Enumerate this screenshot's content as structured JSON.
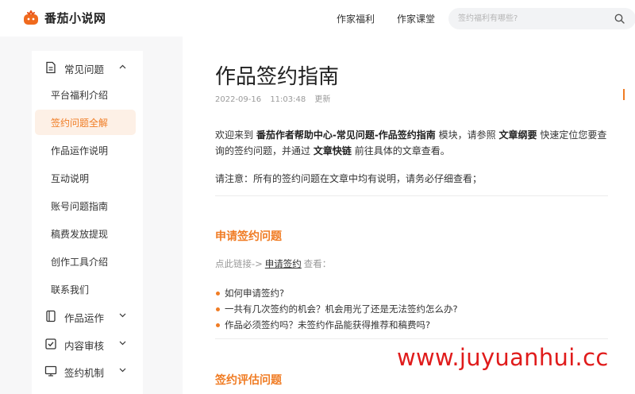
{
  "header": {
    "brand": "番茄小说网",
    "nav": [
      "作家福利",
      "作家课堂"
    ],
    "search_placeholder": "签约福利有哪些?"
  },
  "sidebar": {
    "groups": [
      {
        "label": "常见问题",
        "icon": "document-icon",
        "expanded": true
      },
      {
        "label": "作品运作",
        "icon": "book-icon",
        "expanded": false
      },
      {
        "label": "内容审核",
        "icon": "checkbox-icon",
        "expanded": false
      },
      {
        "label": "签约机制",
        "icon": "monitor-icon",
        "expanded": false
      }
    ],
    "items": [
      "平台福利介绍",
      "签约问题全解",
      "作品运作说明",
      "互动说明",
      "账号问题指南",
      "稿费发放提现",
      "创作工具介绍",
      "联系我们"
    ],
    "active_item": "签约问题全解"
  },
  "article": {
    "title": "作品签约指南",
    "date": "2022-09-16",
    "time": "11:03:48",
    "updated": "更新",
    "intro_1": "欢迎来到",
    "intro_bold_1": "番茄作者帮助中心-常见问题-作品签约指南",
    "intro_2": "模块，请参照",
    "intro_bold_2": "文章纲要",
    "intro_3": "快速定位您要查询的签约问题，并通过",
    "intro_bold_3": "文章快链",
    "intro_4": "前往具体的文章查看。",
    "note": "请注意：所有的签约问题在文章中均有说明，请务必仔细查看；",
    "section1_title": "申请签约问题",
    "link_prefix": "点此链接->",
    "link_text": "申请签约",
    "link_suffix": "查看：",
    "questions": [
      "如何申请签约?",
      "一共有几次签约的机会？机会用光了还是无法签约怎么办?",
      "作品必须签约吗？未签约作品能获得推荐和稿费吗?"
    ],
    "section2_title": "签约评估问题"
  },
  "watermark": "www.juyuanhui.cc",
  "colors": {
    "accent": "#f07c24",
    "watermark": "#e01b1b"
  }
}
